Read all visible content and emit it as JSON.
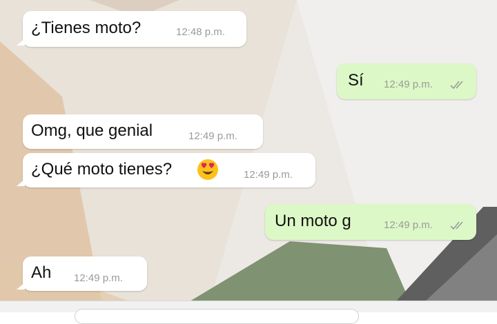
{
  "messages": [
    {
      "direction": "incoming",
      "text": "¿Tienes moto?",
      "time": "12:48 p.m."
    },
    {
      "direction": "outgoing",
      "text": "Sí",
      "time": "12:49 p.m.",
      "status": "delivered-double-check"
    },
    {
      "direction": "incoming",
      "text": "Omg, que genial",
      "time": "12:49 p.m."
    },
    {
      "direction": "incoming",
      "text": "¿Qué moto tienes?",
      "time": "12:49 p.m.",
      "emoji": "heart-eyes-emoji"
    },
    {
      "direction": "outgoing",
      "text": "Un moto g",
      "time": "12:49 p.m.",
      "status": "delivered-double-check"
    },
    {
      "direction": "incoming",
      "text": "Ah",
      "time": "12:49 p.m."
    }
  ],
  "colors": {
    "incoming_bubble": "#ffffff",
    "outgoing_bubble": "#dcf8c6",
    "time_text": "#9a9a9a",
    "check_marks": "#9a9a9a"
  }
}
